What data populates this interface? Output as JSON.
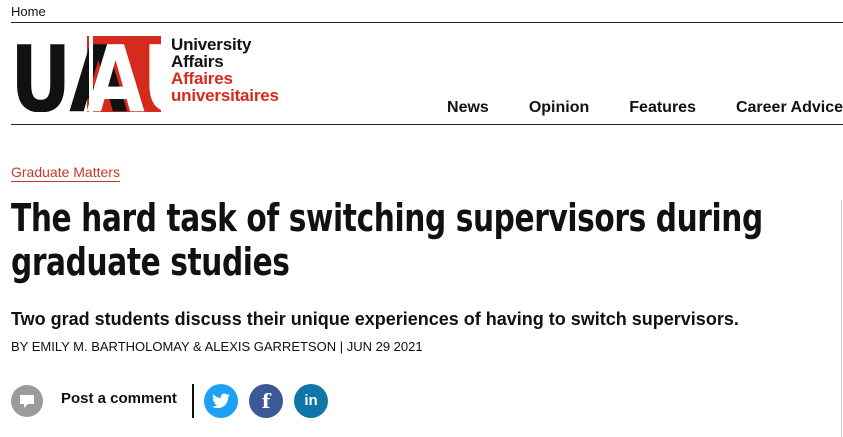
{
  "breadcrumb": {
    "home_label": "Home"
  },
  "logo": {
    "mark_left": "UA",
    "mark_right": "AU",
    "line1": "University",
    "line2": "Affairs",
    "line3": "Affaires",
    "line4": "universitaires",
    "colors": {
      "black": "#111111",
      "red": "#d52b1e"
    }
  },
  "nav": {
    "items": [
      {
        "label": "News"
      },
      {
        "label": "Opinion"
      },
      {
        "label": "Features"
      },
      {
        "label": "Career Advice"
      }
    ]
  },
  "article": {
    "category": "Graduate Matters",
    "title": "The hard task of switching supervisors during graduate studies",
    "subtitle": "Two grad students discuss their unique experiences of having to switch supervisors.",
    "byline": "BY EMILY M. BARTHOLOMAY & ALEXIS GARRETSON | JUN 29 2021"
  },
  "actions": {
    "comment_label": "Post a comment",
    "comment_icon": "speech-bubble-icon",
    "share": [
      {
        "icon": "twitter-icon",
        "color": "#1da1f2"
      },
      {
        "icon": "facebook-icon",
        "label": "f",
        "color": "#3b5998"
      },
      {
        "icon": "linkedin-icon",
        "label": "in",
        "color": "#0e76a8"
      }
    ]
  }
}
